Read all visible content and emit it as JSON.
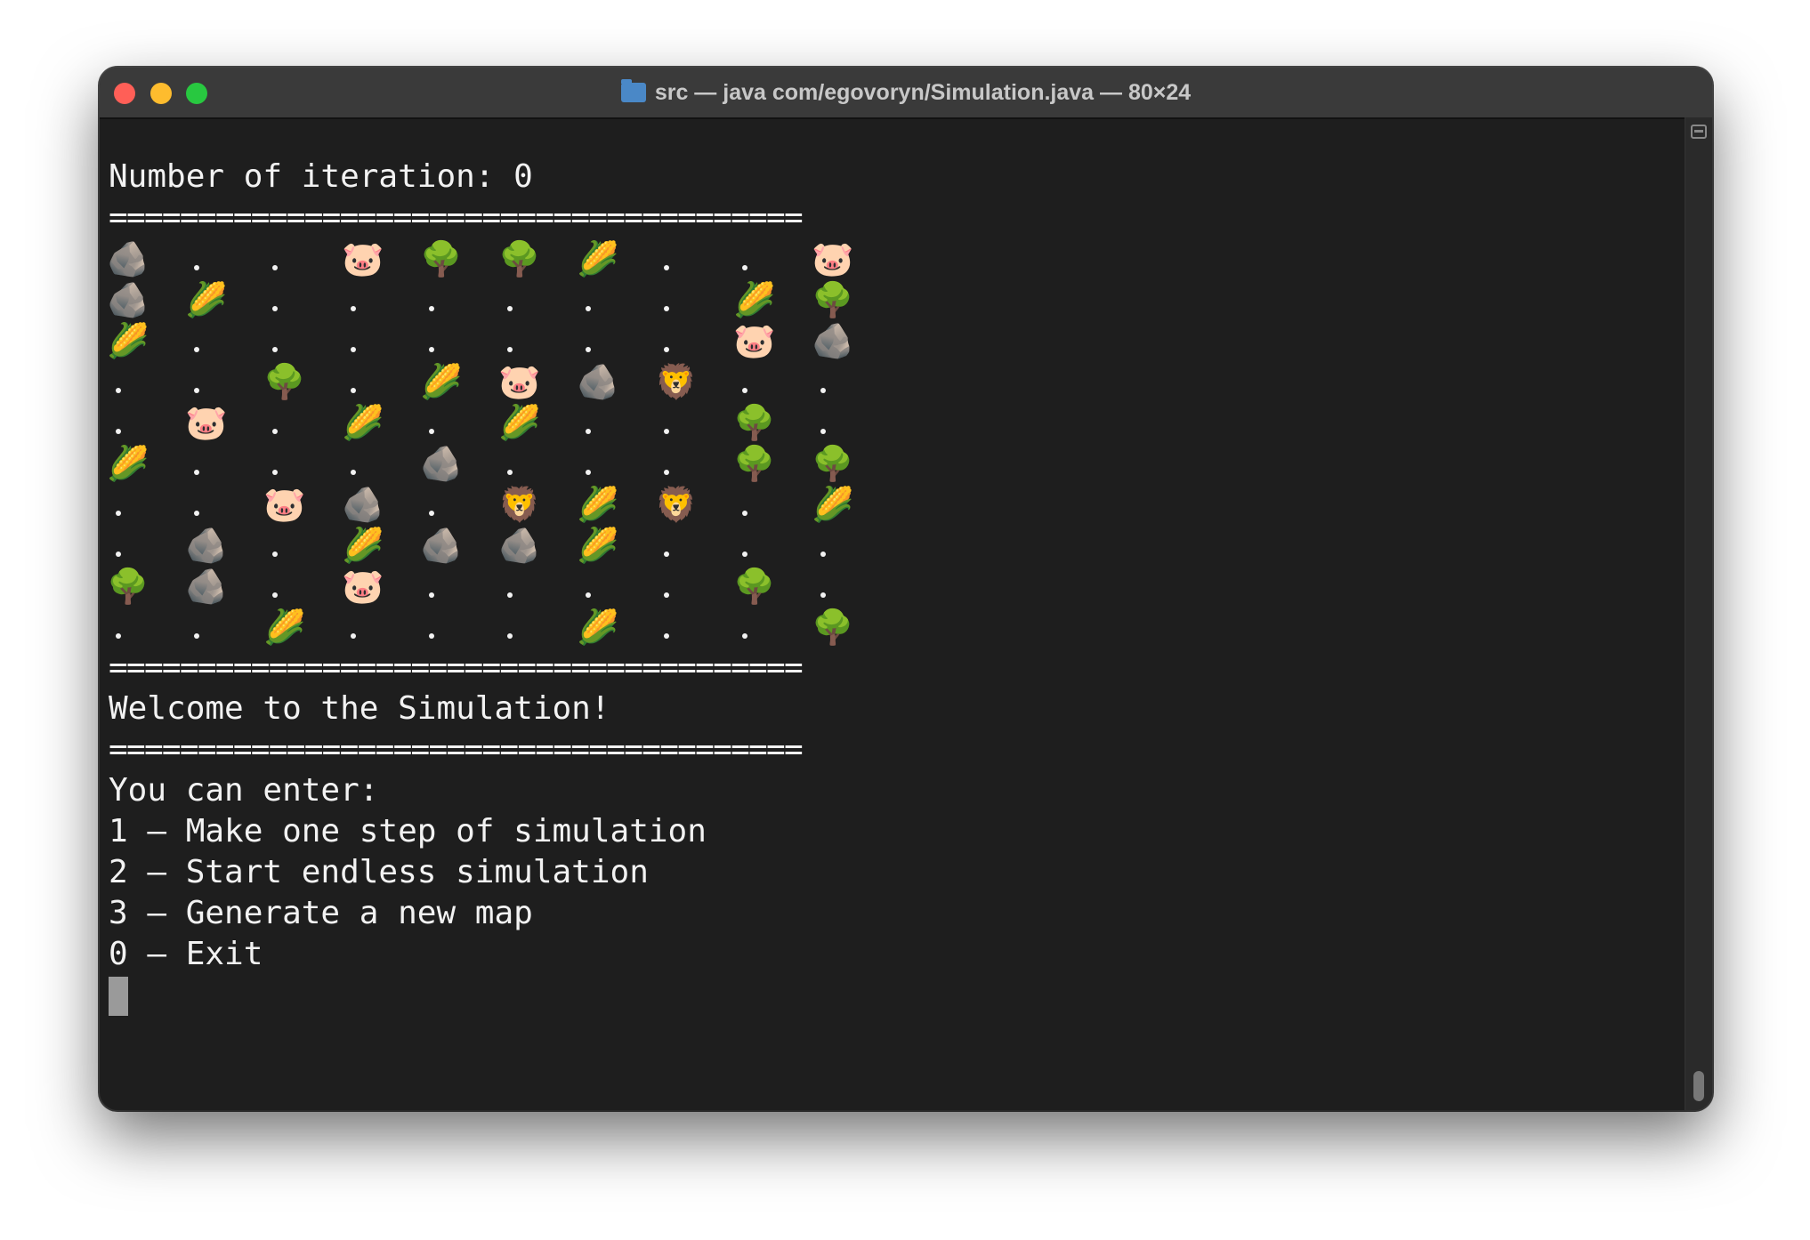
{
  "window": {
    "title": "src — java com/egovoryn/Simulation.java — 80×24"
  },
  "terminal": {
    "iteration_line": "Number of iteration: 0",
    "separator": "=======================================",
    "welcome": "Welcome to the Simulation!",
    "prompt": "You can enter:",
    "options": [
      "1 – Make one step of simulation",
      "2 – Start endless simulation",
      "3 – Generate a new map",
      "0 – Exit"
    ]
  },
  "map": {
    "legend_icons": {
      "R": "rock-icon",
      "P": "pig-icon",
      "T": "tree-icon",
      "C": "corn-icon",
      "L": "lion-icon",
      ".": "empty-cell"
    },
    "rows": [
      "R..PTTC..P",
      "RC......CT",
      "C.......PR.",
      "..T.CPRL..",
      ".P.C.C..T.",
      "C...R...TT",
      "..PR.LCL.C",
      ".R.CRRC...",
      "TR.P....T..",
      "..C...C..T"
    ]
  }
}
